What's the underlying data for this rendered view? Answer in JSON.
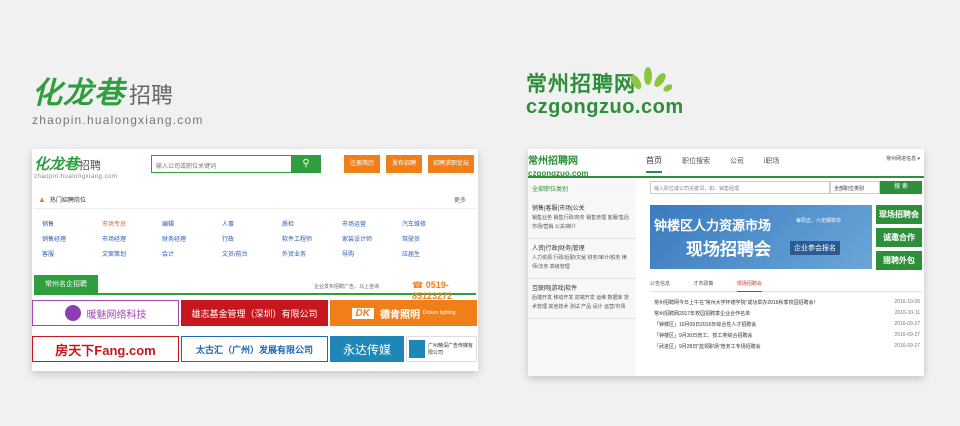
{
  "logo1": {
    "brand": "化龙巷",
    "sub": "招聘",
    "url": "zhaopin.hualongxiang.com"
  },
  "logo2": {
    "cn": "常州招聘网",
    "en": "czgongzuo.com"
  },
  "p1": {
    "logo_brand": "化龙巷",
    "logo_sub": "招聘",
    "logo_url": "zhaopin.hualongxiang.com",
    "search_placeholder": "输入公司或职位关键词",
    "buttons": [
      "注册简历",
      "发布招聘",
      "招聘求职论坛"
    ],
    "hot_title": "热门招聘岗位",
    "more": "更多",
    "jobs": [
      "销售",
      "市场专员",
      "编辑",
      "人事",
      "质检",
      "市场运营",
      "汽车维修",
      "销售经理",
      "市场经理",
      "财务经理",
      "行政",
      "软件工程师",
      "家装设计师",
      "驾驶员",
      "客服",
      "文案策划",
      "会计",
      "文员/前台",
      "外贸业务",
      "导购",
      "应届生"
    ],
    "famous_tag": "常州名企招聘",
    "ad_text": "企业发布招聘广告，马上咨询",
    "phone": "0519-85123272",
    "companies": [
      "暖魅网络科技",
      "雄志基金管理（深圳）有限公司",
      "德肯照明",
      "房天下Fang.com",
      "太古汇（广州）发展有限公司",
      "永达传媒",
      "广州精深广告传媒有限公司"
    ],
    "dk_sub": "Dicken lighting"
  },
  "p2": {
    "logo_cn": "常州招聘网",
    "logo_en": "czgongzuo.com",
    "nav": [
      "首页",
      "职位搜索",
      "公司",
      "i职场"
    ],
    "city": "常州网进信息",
    "all_cat": "全部职位类别",
    "groups": [
      {
        "title": "销售|客服|市场|公关",
        "items": "销售业务  销售行政/商务  销售管理  客服/售后  市场/营销  公关/媒介"
      },
      {
        "title": "人资|行政|财务|管理",
        "items": "人力资源  行政/后勤/文秘  财务/审计/税务  律师/法务  高级管理"
      },
      {
        "title": "互联网|游戏|软件",
        "items": "后端开发  移动开发  前端开发  运维  数据库  技术管理  其他技术  测试  产品  设计  运营/市场"
      }
    ],
    "search_placeholder": "输入职位或公司关键词，如：销售经理",
    "select": "全部职位类别",
    "search_btn": "搜 索",
    "banner": {
      "t1": "钟楼区人力资源市场",
      "t2": "现场招聘会",
      "t3": "每周五、六定期举办",
      "t4": "企业参会报名"
    },
    "side_btns": [
      "现场招聘会",
      "诚邀合作",
      "猎聘外包"
    ],
    "tabs": [
      "公告信息",
      "才市政策",
      "现场招聘会"
    ],
    "news": [
      {
        "t": "常州招聘网今日上午在“常州大学怀德学院”成功举办2016秋季校园招聘会！",
        "d": "2016-10-26"
      },
      {
        "t": "常州招聘网2017年校园招聘季企业合作名单",
        "d": "2016-10-11"
      },
      {
        "t": "「钟楼区」10月09日2016年综合性人才招聘会",
        "d": "2016-09-27"
      },
      {
        "t": "「钟楼区」9月30日普工、技工类综合招聘会",
        "d": "2016-09-27"
      },
      {
        "t": "「武进区」9月28日“蓝领职场”普务工专场招聘会",
        "d": "2016-09-27"
      }
    ]
  }
}
